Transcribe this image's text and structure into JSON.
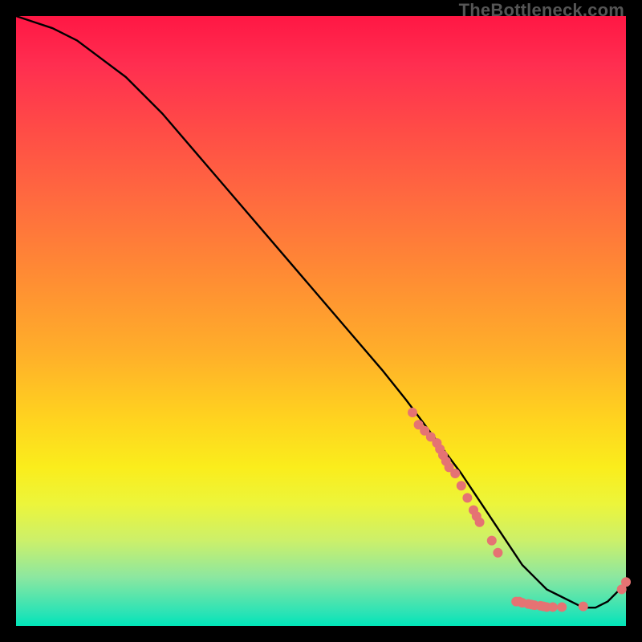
{
  "watermark": "TheBottleneck.com",
  "colors": {
    "line": "#000000",
    "marker_fill": "#e57373",
    "marker_stroke": "#b74b4b"
  },
  "chart_data": {
    "type": "line",
    "title": "",
    "xlabel": "",
    "ylabel": "",
    "xlim": [
      0,
      100
    ],
    "ylim": [
      0,
      100
    ],
    "series": [
      {
        "name": "curve",
        "x": [
          0,
          3,
          6,
          10,
          14,
          18,
          24,
          30,
          36,
          42,
          48,
          54,
          60,
          64,
          67,
          70,
          73,
          75,
          77,
          79,
          81,
          83,
          85,
          87,
          89,
          91,
          93,
          95,
          97,
          98,
          100
        ],
        "y": [
          100,
          99,
          98,
          96,
          93,
          90,
          84,
          77,
          70,
          63,
          56,
          49,
          42,
          37,
          33,
          29,
          25,
          22,
          19,
          16,
          13,
          10,
          8,
          6,
          5,
          4,
          3,
          3,
          4,
          5,
          7
        ]
      }
    ],
    "markers": [
      {
        "x": 65,
        "y": 35
      },
      {
        "x": 66,
        "y": 33
      },
      {
        "x": 67,
        "y": 32
      },
      {
        "x": 68,
        "y": 31
      },
      {
        "x": 69,
        "y": 30
      },
      {
        "x": 69.5,
        "y": 29
      },
      {
        "x": 70,
        "y": 28
      },
      {
        "x": 70.5,
        "y": 27
      },
      {
        "x": 71,
        "y": 26
      },
      {
        "x": 72,
        "y": 25
      },
      {
        "x": 73,
        "y": 23
      },
      {
        "x": 74,
        "y": 21
      },
      {
        "x": 75,
        "y": 19
      },
      {
        "x": 75.5,
        "y": 18
      },
      {
        "x": 76,
        "y": 17
      },
      {
        "x": 78,
        "y": 14
      },
      {
        "x": 79,
        "y": 12
      },
      {
        "x": 82,
        "y": 4
      },
      {
        "x": 82.5,
        "y": 4
      },
      {
        "x": 83,
        "y": 3.8
      },
      {
        "x": 84,
        "y": 3.6
      },
      {
        "x": 84.5,
        "y": 3.5
      },
      {
        "x": 85,
        "y": 3.4
      },
      {
        "x": 86,
        "y": 3.3
      },
      {
        "x": 86.5,
        "y": 3.2
      },
      {
        "x": 87,
        "y": 3.1
      },
      {
        "x": 88,
        "y": 3.1
      },
      {
        "x": 89.5,
        "y": 3.1
      },
      {
        "x": 93,
        "y": 3.2
      },
      {
        "x": 99.3,
        "y": 6
      },
      {
        "x": 100,
        "y": 7.2
      }
    ]
  }
}
